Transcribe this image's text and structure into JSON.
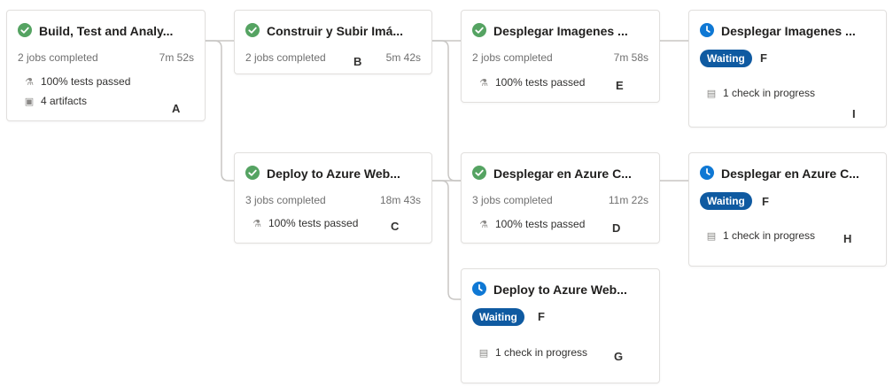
{
  "stages": [
    {
      "id": "s1",
      "title": "Build, Test and Analy...",
      "status": "success",
      "jobs": "2 jobs completed",
      "time": "7m 52s",
      "lines": [
        {
          "icon": "flask",
          "text": "100% tests passed"
        },
        {
          "icon": "artifact",
          "text": "4 artifacts"
        }
      ],
      "tag": "A"
    },
    {
      "id": "s2",
      "title": "Construir y Subir Imá...",
      "status": "success",
      "jobs": "2 jobs completed",
      "time": "5m 42s",
      "tag": "B"
    },
    {
      "id": "s3",
      "title": "Deploy to Azure Web...",
      "status": "success",
      "jobs": "3 jobs completed",
      "time": "18m 43s",
      "lines": [
        {
          "icon": "flask",
          "text": "100% tests passed"
        }
      ],
      "tag": "C"
    },
    {
      "id": "s4",
      "title": "Desplegar Imagenes ...",
      "status": "success",
      "jobs": "2 jobs completed",
      "time": "7m 58s",
      "lines": [
        {
          "icon": "flask",
          "text": "100% tests passed"
        }
      ],
      "tag": "E"
    },
    {
      "id": "s5",
      "title": "Desplegar en Azure C...",
      "status": "success",
      "jobs": "3 jobs completed",
      "time": "11m 22s",
      "lines": [
        {
          "icon": "flask",
          "text": "100% tests passed"
        }
      ],
      "tag": "D"
    },
    {
      "id": "s6",
      "title": "Deploy to Azure Web...",
      "status": "waiting",
      "waiting": "Waiting",
      "waiting_tag": "F",
      "lines": [
        {
          "icon": "check-doc",
          "text": "1 check in progress"
        }
      ],
      "tag": "G"
    },
    {
      "id": "s7",
      "title": "Desplegar Imagenes ...",
      "status": "waiting",
      "waiting": "Waiting",
      "waiting_tag": "F",
      "lines": [
        {
          "icon": "check-doc",
          "text": "1 check in progress"
        }
      ],
      "tag": "I"
    },
    {
      "id": "s8",
      "title": "Desplegar en Azure C...",
      "status": "waiting",
      "waiting": "Waiting",
      "waiting_tag": "F",
      "lines": [
        {
          "icon": "check-doc",
          "text": "1 check in progress"
        }
      ],
      "tag": "H"
    }
  ],
  "colors": {
    "success": "#55a362",
    "waiting": "#0f78d4",
    "pill": "#0f5aa1"
  }
}
